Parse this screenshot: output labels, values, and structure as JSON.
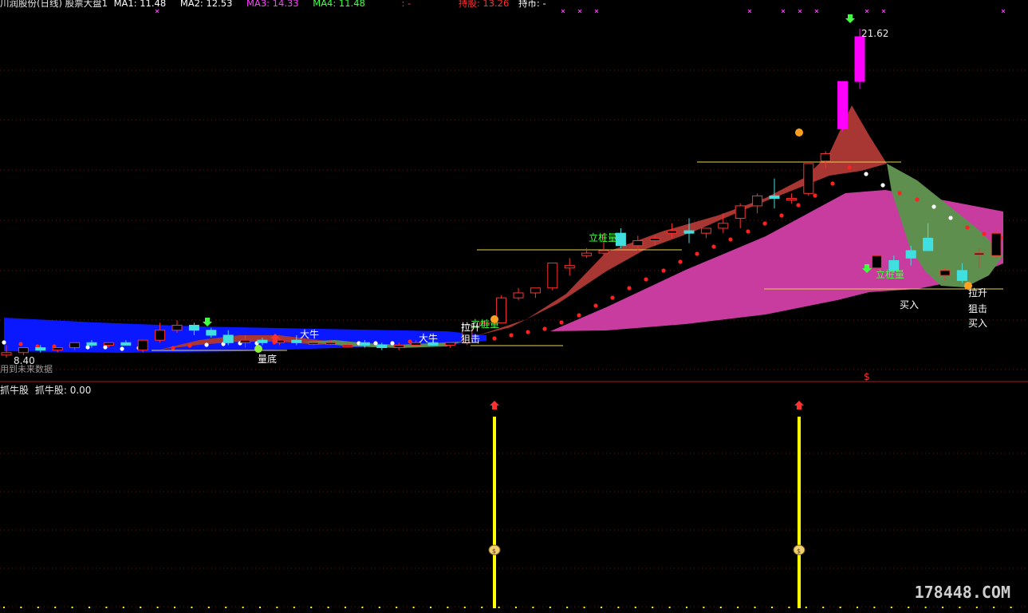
{
  "header": {
    "stock": "川润股份(日线) 股票大盘1",
    "ma1": {
      "label": "MA1: 11.48",
      "color": "#ffffff"
    },
    "ma2": {
      "label": "MA2: 12.53",
      "color": "#ffffff"
    },
    "ma3": {
      "label": "MA3: 14.33",
      "color": "#ff40ff"
    },
    "ma4": {
      "label": "MA4: 11.48",
      "color": "#40ff40"
    },
    "dash": ": -",
    "hold": {
      "label": "持股: 13.26",
      "color": "#ff3030"
    },
    "cash": {
      "label": "持币: -",
      "color": "#ffffff"
    }
  },
  "main_chart": {
    "price_high_label": "21.62",
    "price_low_label": "8.40",
    "future_note": "用到未来数据",
    "annotations": {
      "biao_zhuang_liang": "立桩量",
      "la_sheng": "拉升",
      "ju_ji": "狙击",
      "mai_ru": "买入",
      "da_niu": "大牛",
      "liang_di": "量底",
      "dollar": "$"
    }
  },
  "indicator_panel": {
    "title": "抓牛股",
    "value_label": "抓牛股: 0.00"
  },
  "watermark": "178448.COM",
  "colors": {
    "up_candle": "#ff3030",
    "down_candle": "#40e0e0",
    "bull_candle": "#ff00ff",
    "band_blue": "#0a18ff",
    "band_red": "#a83632",
    "band_magenta": "#c83ca0",
    "band_green": "#5f8f4f",
    "signal_yellow": "#ffff00",
    "grid": "#8a1010"
  },
  "chart_data": {
    "type": "candlestick",
    "y_range": [
      8.4,
      21.62
    ],
    "candles": [
      [
        8.5,
        8.9,
        8.4,
        8.6
      ],
      [
        8.6,
        8.7,
        8.5,
        8.8
      ],
      [
        8.8,
        8.9,
        8.6,
        8.7
      ],
      [
        8.7,
        8.8,
        8.6,
        8.8
      ],
      [
        8.8,
        8.9,
        8.7,
        9.0
      ],
      [
        9.0,
        9.1,
        8.8,
        8.9
      ],
      [
        8.9,
        9.0,
        8.8,
        9.0
      ],
      [
        9.0,
        9.1,
        8.9,
        8.9
      ],
      [
        8.7,
        9.0,
        8.6,
        9.1
      ],
      [
        9.1,
        9.8,
        9.0,
        9.5
      ],
      [
        9.5,
        9.9,
        9.4,
        9.7
      ],
      [
        9.7,
        9.8,
        9.3,
        9.5
      ],
      [
        9.5,
        9.6,
        9.2,
        9.3
      ],
      [
        9.3,
        9.5,
        8.9,
        9.0
      ],
      [
        9.0,
        9.3,
        8.8,
        9.1
      ],
      [
        9.1,
        9.2,
        8.9,
        9.0
      ],
      [
        9.0,
        9.2,
        8.9,
        9.1
      ],
      [
        9.1,
        9.3,
        8.9,
        9.0
      ],
      [
        9.0,
        9.1,
        8.9,
        9.0
      ],
      [
        9.0,
        9.1,
        8.9,
        9.0
      ],
      [
        8.9,
        9.0,
        8.8,
        8.9
      ],
      [
        9.0,
        9.1,
        8.8,
        8.9
      ],
      [
        8.9,
        9.0,
        8.7,
        8.8
      ],
      [
        8.8,
        9.0,
        8.7,
        8.9
      ],
      [
        8.9,
        9.1,
        8.8,
        9.0
      ],
      [
        9.0,
        9.1,
        8.9,
        8.9
      ],
      [
        8.9,
        9.0,
        8.8,
        9.0
      ],
      [
        9.0,
        9.8,
        8.9,
        9.7
      ],
      [
        9.7,
        9.9,
        9.6,
        9.8
      ],
      [
        9.8,
        10.9,
        9.8,
        10.8
      ],
      [
        10.8,
        11.2,
        10.7,
        11.0
      ],
      [
        11.0,
        11.2,
        10.8,
        11.2
      ],
      [
        11.2,
        12.2,
        11.1,
        12.2
      ],
      [
        12.0,
        12.4,
        11.7,
        12.1
      ],
      [
        12.5,
        12.8,
        12.4,
        12.6
      ],
      [
        12.6,
        13.4,
        12.5,
        12.7
      ],
      [
        13.4,
        13.6,
        12.8,
        12.9
      ],
      [
        12.9,
        13.3,
        12.7,
        13.1
      ],
      [
        13.1,
        13.3,
        12.9,
        13.2
      ],
      [
        13.4,
        13.8,
        13.2,
        13.5
      ],
      [
        13.5,
        14.0,
        13.0,
        13.4
      ],
      [
        13.4,
        13.6,
        13.2,
        13.6
      ],
      [
        13.6,
        14.2,
        13.4,
        13.8
      ],
      [
        14.0,
        14.6,
        13.6,
        14.5
      ],
      [
        14.5,
        15.0,
        14.2,
        14.9
      ],
      [
        14.9,
        15.6,
        14.4,
        14.8
      ],
      [
        14.8,
        15.0,
        14.6,
        14.8
      ],
      [
        15.0,
        16.2,
        14.9,
        16.2
      ],
      [
        16.3,
        16.7,
        16.0,
        16.6
      ],
      [
        17.6,
        19.5,
        17.5,
        19.5
      ],
      [
        19.5,
        21.62,
        19.2,
        21.3
      ],
      [
        12.0,
        12.4,
        11.5,
        12.5
      ],
      [
        12.3,
        12.5,
        11.8,
        11.9
      ],
      [
        12.7,
        12.9,
        12.1,
        12.4
      ],
      [
        13.2,
        13.8,
        13.0,
        12.7
      ],
      [
        11.7,
        12.0,
        11.5,
        11.9
      ],
      [
        11.9,
        12.2,
        11.4,
        11.5
      ],
      [
        12.6,
        12.8,
        12.0,
        12.6
      ],
      [
        12.5,
        13.6,
        12.4,
        13.4
      ]
    ],
    "signal_bars_x": [
      620,
      1002
    ],
    "signal_bars_label": "$"
  }
}
